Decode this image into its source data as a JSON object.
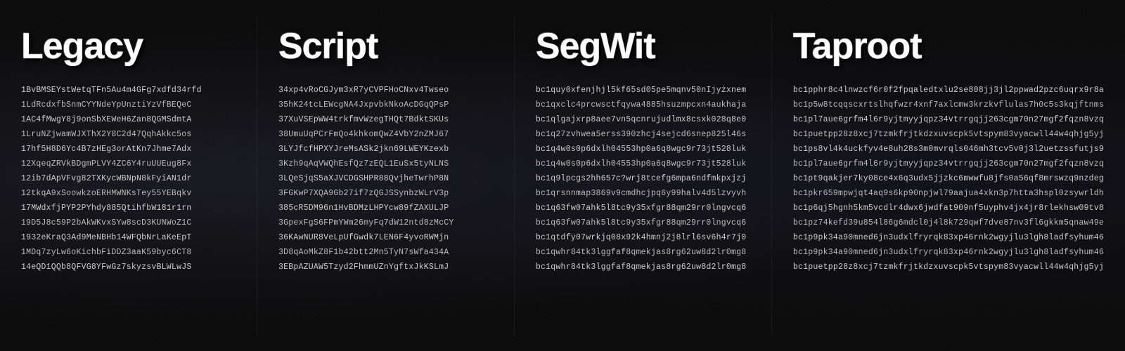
{
  "columns": [
    {
      "id": "legacy",
      "header": "Legacy",
      "addresses": [
        "1BvBMSEYstWetqTFn5Au4m4GFg7xdfd34rfd",
        "1LdRcdxfbSnmCYYNdeYpUnztiYzVfBEQeC",
        "1AC4fMwgY8j9onSbXEWeH6Zan8QGMSdmtA",
        "1LruNZjwamWJXThX2Y8C2d47QqhAkkc5os",
        "17hf5H8D6Yc4B7zHEg3orAtKn7Jhme7Adx",
        "12XqeqZRVkBDgmPLVY4ZC6Y4ruUUEug8Fx",
        "12ib7dApVFvg82TXKycWBNpN8kFyiAN1dr",
        "12tkqA9xSoowkzoERHMWNKsTey55YEBqkv",
        "17MWdxfjPYP2PYhdy885QtihfbW181r1rn",
        "19D5J8c59P2bAkWKvxSYw8scD3KUNWoZ1C",
        "1932eKraQ3Ad9MeNBHb14WFQbNrLaKeEpT",
        "1MDq7zyLw6oKichbFiDDZ3aaK59byc6CT8",
        "14eQD1QQb8QFVG8YFwGz7skyzsvBLWLwJS"
      ]
    },
    {
      "id": "script",
      "header": "Script",
      "addresses": [
        "34xp4vRoCGJym3xR7yCVPFHoCNxv4Twseo",
        "35hK24tcLEWcgNA4JxpvbkNkoAcDGqQPsP",
        "37XuVSEpWW4trkfmvWzegTHQt7BdktSKUs",
        "38UmuUqPCrFmQo4khkomQwZ4VbY2nZMJ67",
        "3LYJfcfHPXYJreMsASk2jkn69LWEYKzexb",
        "3Kzh9qAqVWQhEsfQz7zEQL1EuSx5tyNLNS",
        "3LQeSjqS5aXJVCDGSHPR88QvjheTwrhP8N",
        "3FGKwP7XQA9Gb27if7zQGJSSynbzWLrV3p",
        "385cR5DM96n1HvBDMzLHPYcw89fZAXULJP",
        "3GpexFgS6FPmYWm26myFq7dW12ntd8zMcCY",
        "36KAwNUR8VeLpUfGwdk7LEN6F4yvoRWMjn",
        "3D8qAoMkZ8F1b42btt2Mn5TyN7sWfa434A",
        "3EBpAZUAW5Tzyd2FhmmUZnYgftxJkKSLmJ"
      ]
    },
    {
      "id": "segwit",
      "header": "SegWit",
      "addresses": [
        "bc1quy0xfenjhjl5kf65sd05pe5mqnv50nIjyżxnem",
        "bc1qxclc4prcwsctfqywa4885hsuzmpcxn4aukhaja",
        "bc1qlgajxrp8aee7vn5qcnrujudlmx8csxk028q8e0",
        "bc1q27zvhwea5erss390zhcj4sejcd6snep825l46s",
        "bc1q4w0s0p6dxlh04553hp0a6q8wgc9r73jt528luk",
        "bc1q4w0s0p6dxlh04553hp0a6q8wgc9r73jt528luk",
        "bc1q9lpcgs2hh657c?wrj8tcefg6mpa6ndfmkpxjzj",
        "bc1qrsnnmap3869v9cmdhcjpq6y99halv4d5lzvyvh",
        "bc1q63fw07ahk5l8tc9y35xfgr88qm29rr0lngvcq6",
        "bc1q63fw07ahk5l8tc9y35xfgr88qm29rr0lngvcq6",
        "bc1qtdfy07wrkjq08x92k4hmnj2j8lrl6sv6h4r7j0",
        "bc1qwhr84tk3lggfaf8qmekjas8rg62uw8d2lr0mg8",
        "bc1qwhr84tk3lggfaf8qmekjas8rg62uw8d2lr0mg8"
      ]
    },
    {
      "id": "taproot",
      "header": "Taproot",
      "addresses": [
        "bc1pphr8c4lnwzcf6r0f2fpqaledtxlu2se808jj3jl2ppwad2pzc6uqrx9r8a",
        "bc1p5w8tcqqscxrtslhqfwzr4xnf7axlcmw3krzkvflulas7h0c5s3kqjftnms",
        "bc1pl7aue6grfm4l6r9yjtmyyjqpz34vtrrgqjj263cgm70n27mgf2fqzn8vzq",
        "bc1puetpp28z8xcj7tzmkfrjtkdzxuvscpk5vtspym83vyacwll44w4qhjg5yj",
        "bc1ps8vl4k4uckfyv4e8uh28s3m0mvrqls046mh3tcv5v0j3l2uetzssfutjs9",
        "bc1pl7aue6grfm4l6r9yjtmyyjqpz34vtrrgqjj263cgm70n27mgf2fqzn8vzq",
        "bc1pt9qakjer7ky08ce4x6q3udx5jjzkc6mwwfu8jfs0a56qf8mrswzq9nzdeg",
        "bc1pkr659mpwjqt4aq9s6kp90npjwl79aajua4xkn3p7htta3hspl0zsywrldh",
        "bc1p6qj5hgnh5km5vcdlr4dwx6jwdfat909nf5uyphv4jx4jr8rlekhsw09tv8",
        "bc1pz74kefd39u854l86g6mdcl0j4l8k729qwf7dve87nv3fl6gkkm5qnaw49e",
        "bc1p9pk34a90mned6jn3udxlfryrqk83xp46rnk2wgyjlu3lgh8ladfsyhum46",
        "bc1p9pk34a90mned6jn3udxlfryrqk83xp46rnk2wgyjlu3lgh8ladfsyhum46",
        "bc1puetpp28z8xcj7tzmkfrjtkdzxuvscpk5vtspym83vyacwll44w4qhjg5yj"
      ]
    }
  ]
}
